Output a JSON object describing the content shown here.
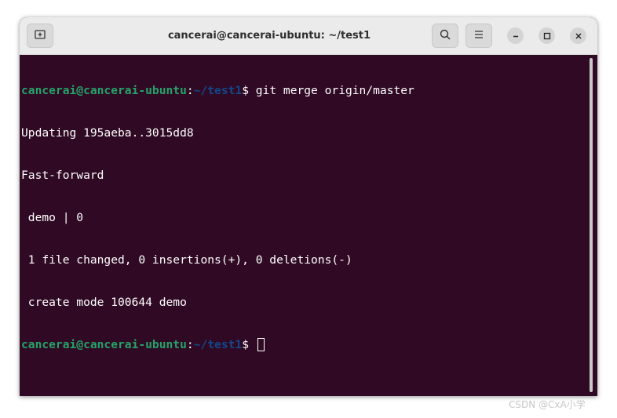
{
  "window": {
    "title": "cancerai@cancerai-ubuntu: ~/test1"
  },
  "titlebar": {
    "icons": [
      "new-tab-icon",
      "search-icon",
      "hamburger-menu-icon",
      "minimize-icon",
      "maximize-icon",
      "close-icon"
    ]
  },
  "colors": {
    "terminal_bg": "#300a24",
    "prompt_user": "#26a269",
    "prompt_path": "#12488b",
    "text": "#ffffff",
    "titlebar_bg": "#ebebeb"
  },
  "terminal": {
    "prompt1": {
      "user": "cancerai@cancerai-ubuntu",
      "colon": ":",
      "path": "~/test1",
      "symbol": "$ ",
      "command": "git merge origin/master"
    },
    "output": [
      "Updating 195aeba..3015dd8",
      "Fast-forward",
      " demo | 0",
      " 1 file changed, 0 insertions(+), 0 deletions(-)",
      " create mode 100644 demo"
    ],
    "prompt2": {
      "user": "cancerai@cancerai-ubuntu",
      "colon": ":",
      "path": "~/test1",
      "symbol": "$ ",
      "command": ""
    }
  },
  "watermark": "CSDN @CxA小学"
}
